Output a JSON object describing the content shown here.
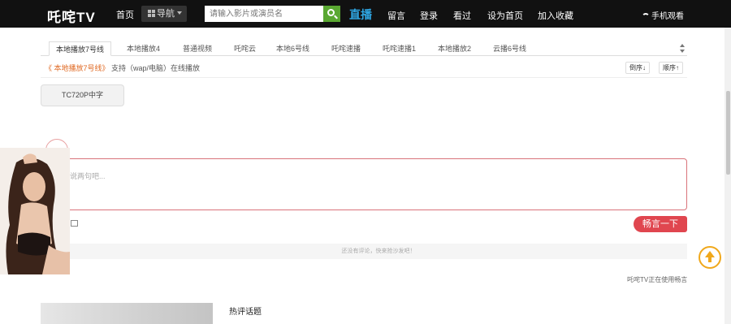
{
  "header": {
    "logo": "吒咤TV",
    "home": "首页",
    "nav_menu": "导航",
    "search_placeholder": "请输入影片或演员名",
    "live": "直播",
    "links": [
      "留言",
      "登录",
      "看过",
      "设为首页",
      "加入收藏"
    ],
    "mobile": "手机观看"
  },
  "player": {
    "tabs": [
      "本地播放7号线",
      "本地播放4",
      "普通视频",
      "吒咤云",
      "本地6号线",
      "吒咤速播",
      "吒咤速播1",
      "本地播放2",
      "云播6号线"
    ],
    "current_line": "《 本地播放7号线》",
    "support_text": "支持（wap/电脑）在线播放",
    "sort_desc": "倒序↓",
    "sort_asc": "顺序↑",
    "episodes": [
      "TC720P中字"
    ]
  },
  "comments": {
    "placeholder": "说两句吧...",
    "send": "畅言一下",
    "empty": "还没有评论，快来抢沙发吧！",
    "powered": "吒咤TV正在使用畅言"
  },
  "bottom": {
    "hot_title": "热评话题"
  },
  "colors": {
    "topbar": "#111111",
    "live": "#2fa7e4",
    "search_btn": "#5aa832",
    "current_line": "#e06a24",
    "send_btn": "#e0464f",
    "totop": "#f0a81c"
  }
}
